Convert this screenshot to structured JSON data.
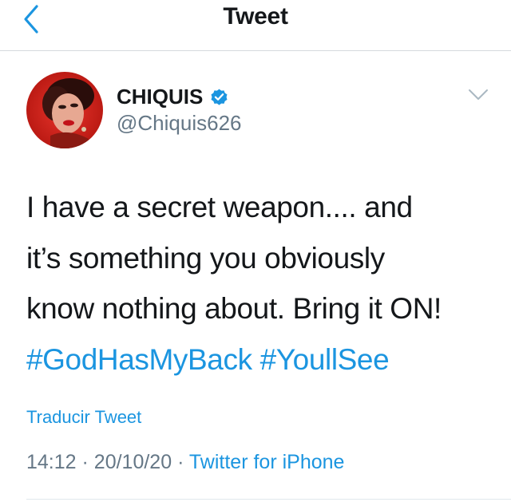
{
  "nav": {
    "back_icon": "chevron-left-icon",
    "title": "Tweet"
  },
  "author": {
    "name": "CHIQUIS",
    "handle": "@Chiquis626",
    "verified": true,
    "verified_icon": "verified-badge-icon",
    "avatar_icon": "profile-photo"
  },
  "tweet": {
    "more_icon": "chevron-down-icon",
    "lines": [
      "I have a secret weapon.... and",
      "it’s something you obviously",
      "know nothing about. Bring it ON!"
    ],
    "hashtags": [
      "#GodHasMyBack",
      "#YoullSee"
    ],
    "translate_label": "Traducir Tweet",
    "time": "14:12",
    "date": "20/10/20",
    "separator": "·",
    "source": "Twitter for iPhone"
  },
  "colors": {
    "accent": "#1b95e0",
    "text": "#14171a",
    "secondary": "#657786",
    "divider": "#d6dade"
  }
}
